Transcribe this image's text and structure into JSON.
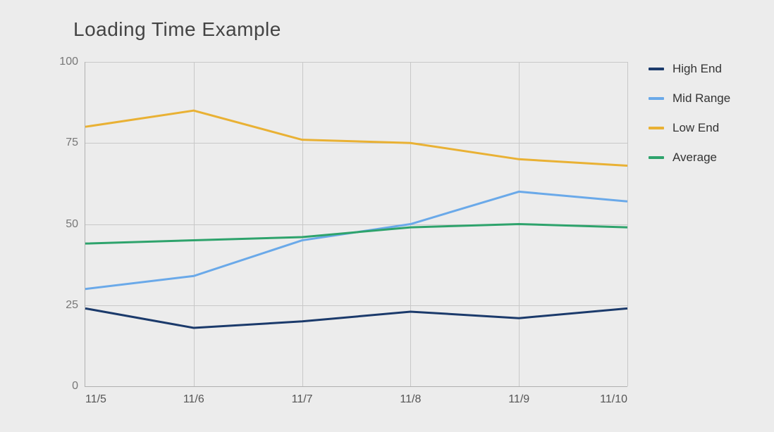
{
  "chart_data": {
    "type": "line",
    "title": "Loading Time Example",
    "categories": [
      "11/5",
      "11/6",
      "11/7",
      "11/8",
      "11/9",
      "11/10"
    ],
    "ylim": [
      0,
      100
    ],
    "yticks": [
      0,
      25,
      50,
      75,
      100
    ],
    "series": [
      {
        "name": "High End",
        "color": "#1b3a6b",
        "values": [
          24,
          18,
          20,
          23,
          21,
          24
        ]
      },
      {
        "name": "Mid Range",
        "color": "#6aa9e9",
        "values": [
          30,
          34,
          45,
          50,
          60,
          57
        ]
      },
      {
        "name": "Low End",
        "color": "#e9b134",
        "values": [
          80,
          85,
          76,
          75,
          70,
          68
        ]
      },
      {
        "name": "Average",
        "color": "#2ea36c",
        "values": [
          44,
          45,
          46,
          49,
          50,
          49
        ]
      }
    ]
  }
}
